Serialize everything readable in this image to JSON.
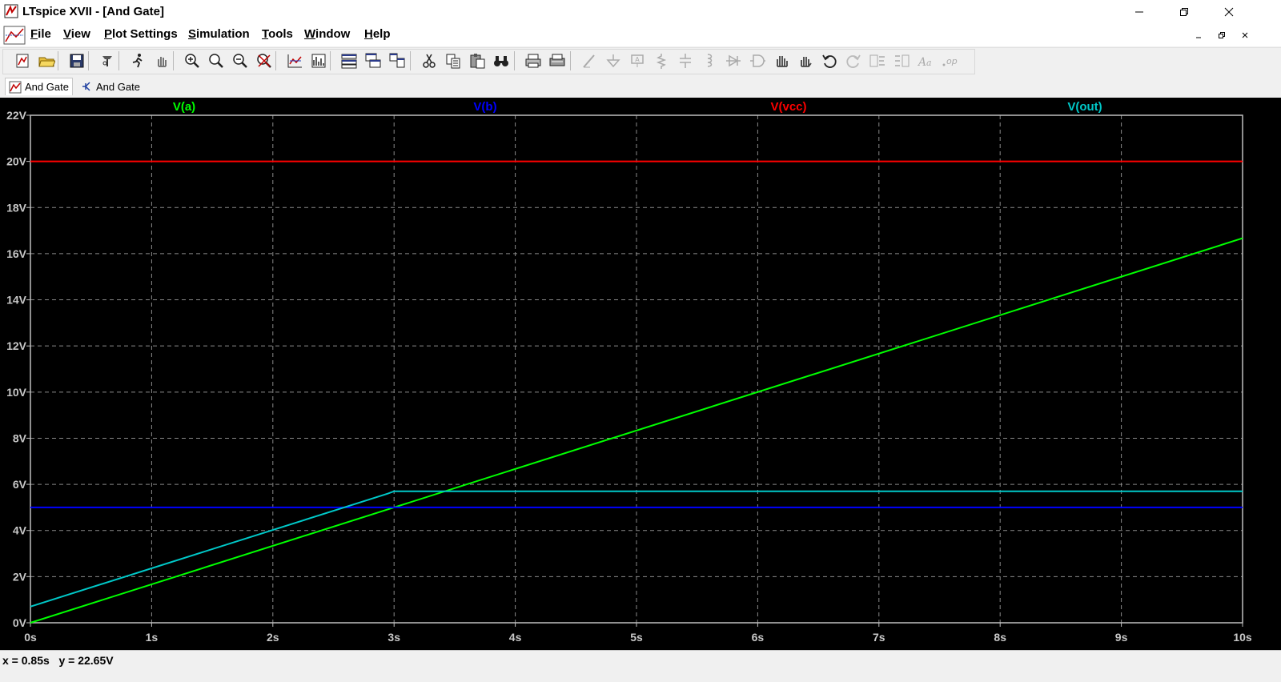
{
  "window": {
    "title": "LTspice XVII - [And Gate]"
  },
  "menu": {
    "items": [
      {
        "key": "F",
        "rest": "ile"
      },
      {
        "key": "V",
        "rest": "iew"
      },
      {
        "key": "P",
        "rest": "lot Settings"
      },
      {
        "key": "S",
        "rest": "imulation"
      },
      {
        "key": "T",
        "rest": "ools"
      },
      {
        "key": "W",
        "rest": "indow"
      },
      {
        "key": "H",
        "rest": "elp"
      }
    ]
  },
  "toolbar": {
    "icons": [
      "new-schematic-icon",
      "open-icon",
      "save-icon",
      "control-panel-icon",
      "run-icon",
      "pan-icon",
      "zoom-in-icon",
      "zoom-box-icon",
      "zoom-out-icon",
      "zoom-cancel-icon",
      "autorange-icon",
      "fft-icon",
      "tile-horizontal-icon",
      "cascade-icon",
      "tile-vertical-icon",
      "cut-icon",
      "copy-icon",
      "paste-icon",
      "find-icon",
      "print-icon",
      "print-setup-icon",
      "wire-icon",
      "ground-icon",
      "label-icon",
      "resistor-icon",
      "capacitor-icon",
      "inductor-icon",
      "diode-icon",
      "component-icon",
      "move-icon",
      "drag-icon",
      "undo-icon",
      "redo-icon",
      "rotate-icon",
      "mirror-icon",
      "text-icon",
      "spice-directive-icon"
    ]
  },
  "tabs": [
    {
      "label": "And Gate",
      "kind": "waveform",
      "active": true
    },
    {
      "label": "And Gate",
      "kind": "schematic",
      "active": false
    }
  ],
  "status": {
    "x_readout": "x = 0.85s",
    "y_readout": "y = 22.65V"
  },
  "chart_data": {
    "type": "line",
    "title": "",
    "xlabel": "",
    "ylabel": "",
    "xlim": [
      0,
      10
    ],
    "ylim": [
      0,
      22
    ],
    "x_ticks": [
      "0s",
      "1s",
      "2s",
      "3s",
      "4s",
      "5s",
      "6s",
      "7s",
      "8s",
      "9s",
      "10s"
    ],
    "y_ticks": [
      "0V",
      "2V",
      "4V",
      "6V",
      "8V",
      "10V",
      "12V",
      "14V",
      "16V",
      "18V",
      "20V",
      "22V"
    ],
    "grid": true,
    "background": "#000000",
    "series": [
      {
        "name": "V(a)",
        "color": "#00ff00",
        "x": [
          0,
          10
        ],
        "y": [
          0,
          16.67
        ]
      },
      {
        "name": "V(b)",
        "color": "#0000ff",
        "x": [
          0,
          10
        ],
        "y": [
          5,
          5
        ]
      },
      {
        "name": "V(vcc)",
        "color": "#ff0000",
        "x": [
          0,
          10
        ],
        "y": [
          20,
          20
        ]
      },
      {
        "name": "V(out)",
        "color": "#00c8c8",
        "x": [
          0,
          2.95,
          3.0,
          10
        ],
        "y": [
          0.7,
          5.6,
          5.7,
          5.7
        ]
      }
    ]
  }
}
